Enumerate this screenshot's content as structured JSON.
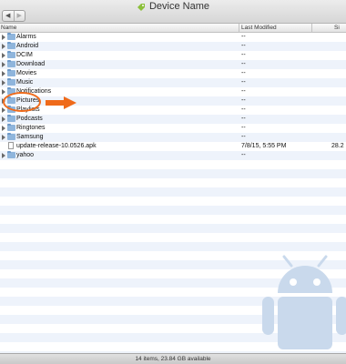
{
  "window": {
    "title": "Device Name",
    "nav_back": "◀",
    "nav_forward": "▶"
  },
  "columns": {
    "name": "Name",
    "modified": "Last Modified",
    "size": "Si"
  },
  "items": [
    {
      "name": "Alarms",
      "type": "folder",
      "modified": "--",
      "size": ""
    },
    {
      "name": "Android",
      "type": "folder",
      "modified": "--",
      "size": ""
    },
    {
      "name": "DCIM",
      "type": "folder",
      "modified": "--",
      "size": ""
    },
    {
      "name": "Download",
      "type": "folder",
      "modified": "--",
      "size": ""
    },
    {
      "name": "Movies",
      "type": "folder",
      "modified": "--",
      "size": ""
    },
    {
      "name": "Music",
      "type": "folder",
      "modified": "--",
      "size": ""
    },
    {
      "name": "Notifications",
      "type": "folder",
      "modified": "--",
      "size": ""
    },
    {
      "name": "Pictures",
      "type": "folder",
      "modified": "--",
      "size": ""
    },
    {
      "name": "Playlists",
      "type": "folder",
      "modified": "--",
      "size": ""
    },
    {
      "name": "Podcasts",
      "type": "folder",
      "modified": "--",
      "size": ""
    },
    {
      "name": "Ringtones",
      "type": "folder",
      "modified": "--",
      "size": ""
    },
    {
      "name": "Samsung",
      "type": "folder",
      "modified": "--",
      "size": ""
    },
    {
      "name": "update-release-10.0526.apk",
      "type": "file",
      "modified": "7/8/15, 5:55 PM",
      "size": "28.2"
    },
    {
      "name": "yahoo",
      "type": "folder",
      "modified": "--",
      "size": ""
    }
  ],
  "status": {
    "text": "14 items, 23.84 GB available"
  },
  "colors": {
    "accent_annotation": "#ef6a1a",
    "android_watermark": "#c9d9ec",
    "row_alt": "#eef3fb"
  },
  "icons": {
    "folder": "folder-icon",
    "file": "file-icon",
    "expand": "disclosure-triangle-icon",
    "title": "android-device-icon",
    "watermark": "android-robot-icon"
  }
}
